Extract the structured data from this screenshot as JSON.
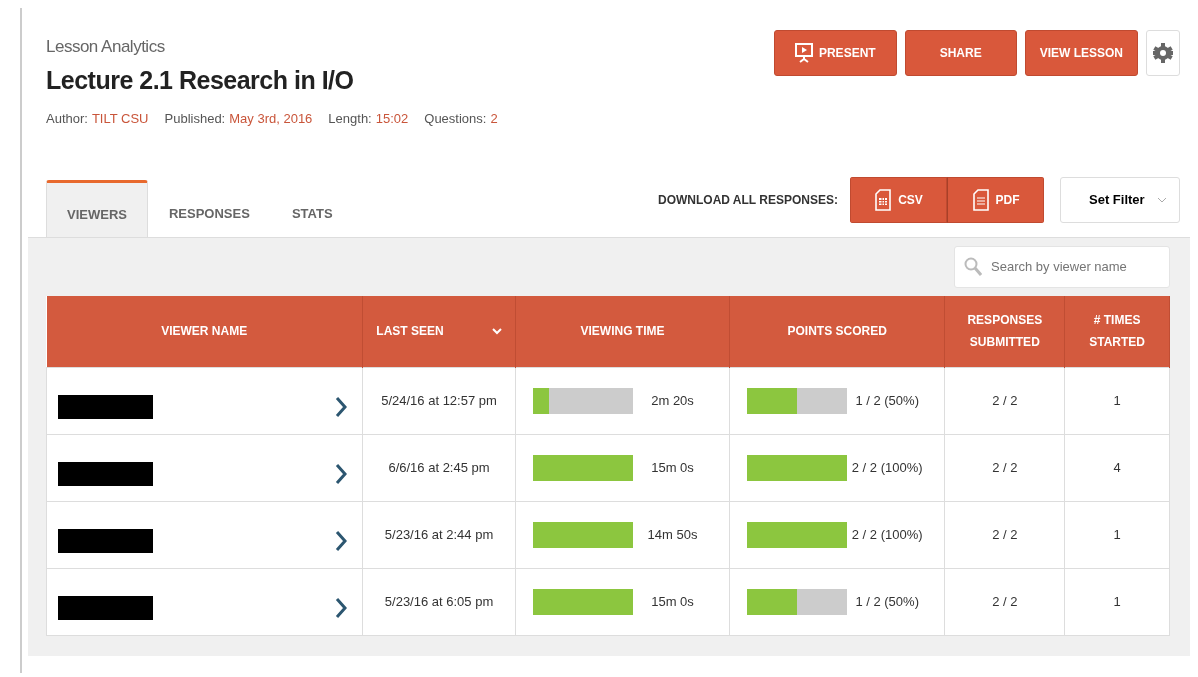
{
  "header": {
    "subtitle": "Lesson Analytics",
    "title": "Lecture 2.1 Research in I/O",
    "meta": [
      {
        "label": "Author:",
        "value": "TILT CSU"
      },
      {
        "label": "Published:",
        "value": "May 3rd, 2016"
      },
      {
        "label": "Length:",
        "value": "15:02"
      },
      {
        "label": "Questions:",
        "value": "2"
      }
    ],
    "actions": [
      {
        "label": "PRESENT",
        "kind": "present"
      },
      {
        "label": "SHARE",
        "kind": "plain"
      },
      {
        "label": "VIEW LESSON",
        "kind": "plain"
      }
    ]
  },
  "tabs": [
    {
      "label": "VIEWERS",
      "selected": true
    },
    {
      "label": "RESPONSES",
      "selected": false
    },
    {
      "label": "STATS",
      "selected": false
    }
  ],
  "download": {
    "label": "DOWNLOAD ALL RESPONSES:",
    "formats": [
      {
        "label": "CSV",
        "kind": "sheet"
      },
      {
        "label": "PDF",
        "kind": "doc"
      }
    ]
  },
  "filter": {
    "label": "Set Filter"
  },
  "search": {
    "placeholder": "Search by viewer name"
  },
  "table": {
    "columns": [
      {
        "label": "VIEWER NAME"
      },
      {
        "label": "LAST SEEN",
        "sortable": true
      },
      {
        "label": "VIEWING TIME"
      },
      {
        "label": "POINTS SCORED"
      },
      {
        "label": "RESPONSES SUBMITTED"
      },
      {
        "label": "# TIMES STARTED"
      }
    ],
    "rows": [
      {
        "last_seen": "5/24/16 at 12:57 pm",
        "viewing": {
          "level": 0.16,
          "reading": "2m 20s"
        },
        "points": {
          "level": 0.5,
          "reading": "1 / 2 (50%)"
        },
        "responses": "2 / 2",
        "times": "1"
      },
      {
        "last_seen": "6/6/16 at 2:45 pm",
        "viewing": {
          "level": 1,
          "reading": "15m 0s"
        },
        "points": {
          "level": 1,
          "reading": "2 / 2 (100%)"
        },
        "responses": "2 / 2",
        "times": "4"
      },
      {
        "last_seen": "5/23/16 at 2:44 pm",
        "viewing": {
          "level": 1,
          "reading": "14m 50s"
        },
        "points": {
          "level": 1,
          "reading": "2 / 2 (100%)"
        },
        "responses": "2 / 2",
        "times": "1"
      },
      {
        "last_seen": "5/23/16 at 6:05 pm",
        "viewing": {
          "level": 1,
          "reading": "15m 0s"
        },
        "points": {
          "level": 0.5,
          "reading": "1 / 2 (50%)"
        },
        "responses": "2 / 2",
        "times": "1"
      }
    ]
  }
}
